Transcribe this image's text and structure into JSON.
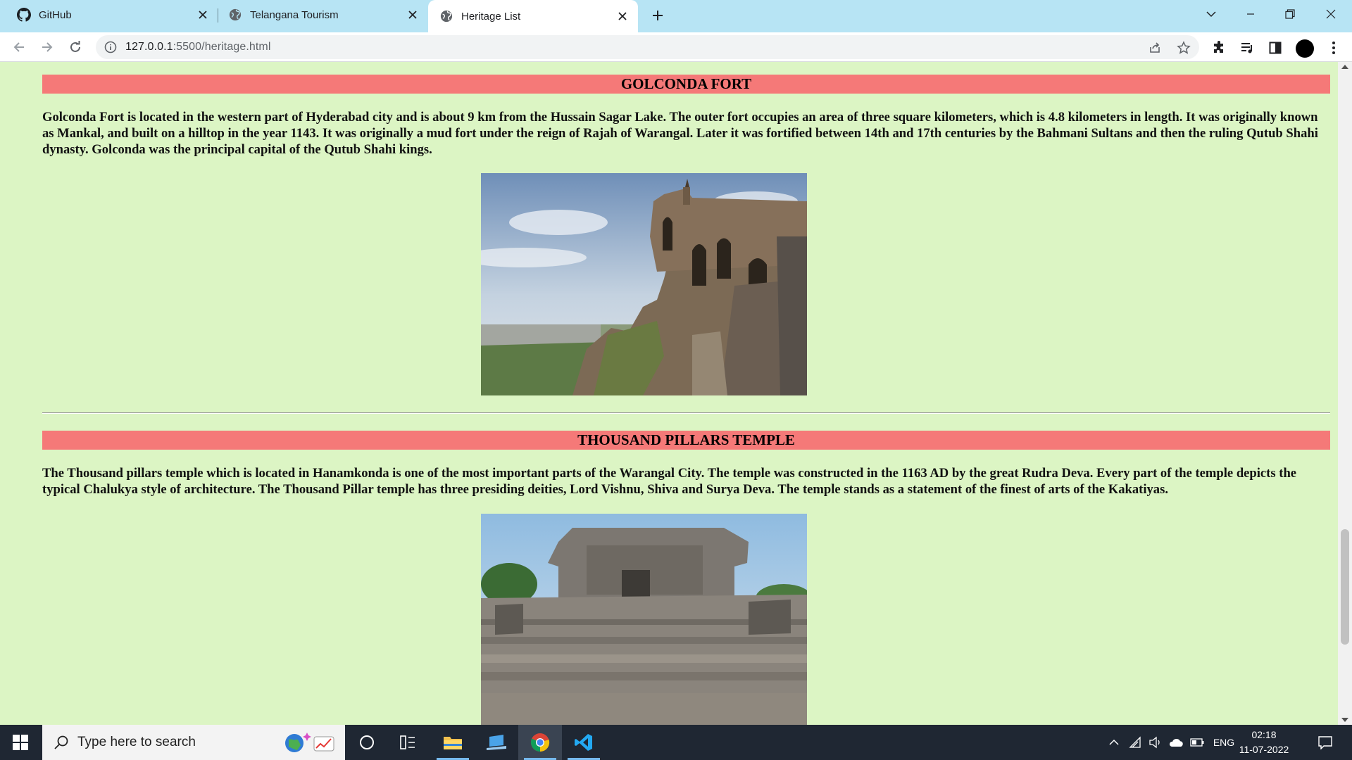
{
  "browser": {
    "tabs": [
      {
        "label": "GitHub",
        "icon": "github-icon",
        "active": false
      },
      {
        "label": "Telangana Tourism",
        "icon": "globe-icon",
        "active": false
      },
      {
        "label": "Heritage List",
        "icon": "globe-icon",
        "active": true
      }
    ],
    "url_host": "127.0.0.1",
    "url_rest": ":5500/heritage.html"
  },
  "page": {
    "sections": [
      {
        "heading": "GOLCONDA FORT",
        "paragraph": "Golconda Fort is located in the western part of Hyderabad city and is about 9 km from the Hussain Sagar Lake. The outer fort occupies an area of three square kilometers, which is 4.8 kilometers in length. It was originally known as Mankal, and built on a hilltop in the year 1143. It was originally a mud fort under the reign of Rajah of Warangal. Later it was fortified between 14th and 17th centuries by the Bahmani Sultans and then the ruling Qutub Shahi dynasty. Golconda was the principal capital of the Qutub Shahi kings."
      },
      {
        "heading": "THOUSAND PILLARS TEMPLE",
        "paragraph": "The Thousand pillars temple which is located in Hanamkonda is one of the most important parts of the Warangal City. The temple was constructed in the 1163 AD by the great Rudra Deva. Every part of the temple depicts the typical Chalukya style of architecture. The Thousand Pillar temple has three presiding deities, Lord Vishnu, Shiva and Surya Deva. The temple stands as a statement of the finest of arts of the Kakatiyas."
      }
    ],
    "colors": {
      "background": "#dcf5c4",
      "heading_bar": "#f57978"
    }
  },
  "taskbar": {
    "search_placeholder": "Type here to search",
    "language": "ENG",
    "time": "02:18",
    "date": "11-07-2022"
  }
}
